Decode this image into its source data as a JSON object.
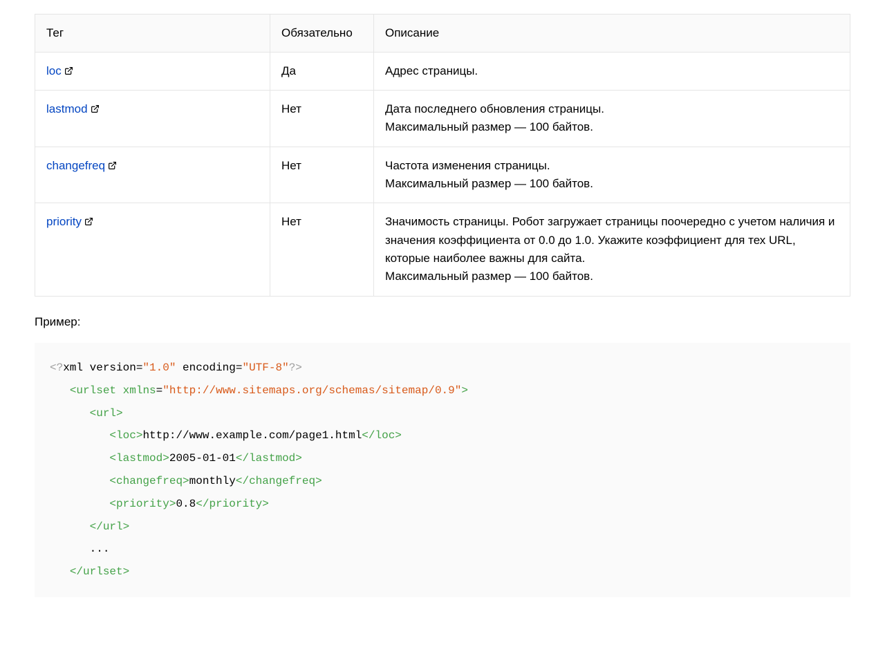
{
  "table": {
    "headers": {
      "tag": "Тег",
      "required": "Обязательно",
      "description": "Описание"
    },
    "rows": [
      {
        "tag": "loc",
        "required": "Да",
        "desc1": "Адрес страницы.",
        "desc2": ""
      },
      {
        "tag": "lastmod",
        "required": "Нет",
        "desc1": "Дата последнего обновления страницы.",
        "desc2": "Максимальный размер — 100 байтов."
      },
      {
        "tag": "changefreq",
        "required": "Нет",
        "desc1": "Частота изменения страницы.",
        "desc2": "Максимальный размер — 100 байтов."
      },
      {
        "tag": "priority",
        "required": "Нет",
        "desc1": "Значимость страницы. Робот загружает страницы поочередно с учетом наличия и значения коэффициента от 0.0 до 1.0. Укажите коэффициент для тех URL, которые наиболее важны для сайта.",
        "desc2": "Максимальный размер — 100 байтов."
      }
    ]
  },
  "exampleLabel": "Пример:",
  "code": {
    "xmlVersion": "1.0",
    "encoding": "UTF-8",
    "xmlns": "http://www.sitemaps.org/schemas/sitemap/0.9",
    "loc": "http://www.example.com/page1.html",
    "lastmod": "2005-01-01",
    "changefreq": "monthly",
    "priority": "0.8"
  }
}
